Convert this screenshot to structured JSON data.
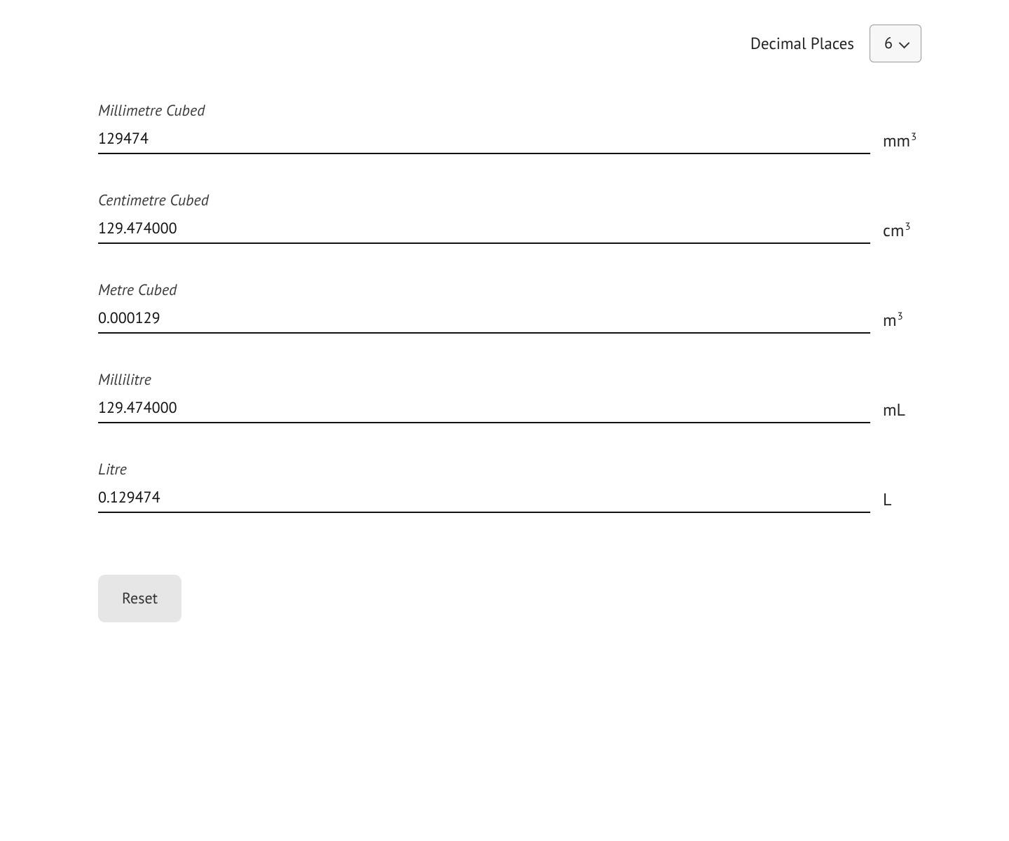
{
  "decimal": {
    "label": "Decimal Places",
    "value": "6"
  },
  "fields": [
    {
      "label": "Millimetre Cubed",
      "value": "129474",
      "unit_base": "mm",
      "sup": "3"
    },
    {
      "label": "Centimetre Cubed",
      "value": "129.474000",
      "unit_base": "cm",
      "sup": "3"
    },
    {
      "label": "Metre Cubed",
      "value": "0.000129",
      "unit_base": "m",
      "sup": "3"
    },
    {
      "label": "Millilitre",
      "value": "129.474000",
      "unit_base": "mL",
      "sup": ""
    },
    {
      "label": "Litre",
      "value": "0.129474",
      "unit_base": "L",
      "sup": ""
    }
  ],
  "reset_label": "Reset"
}
